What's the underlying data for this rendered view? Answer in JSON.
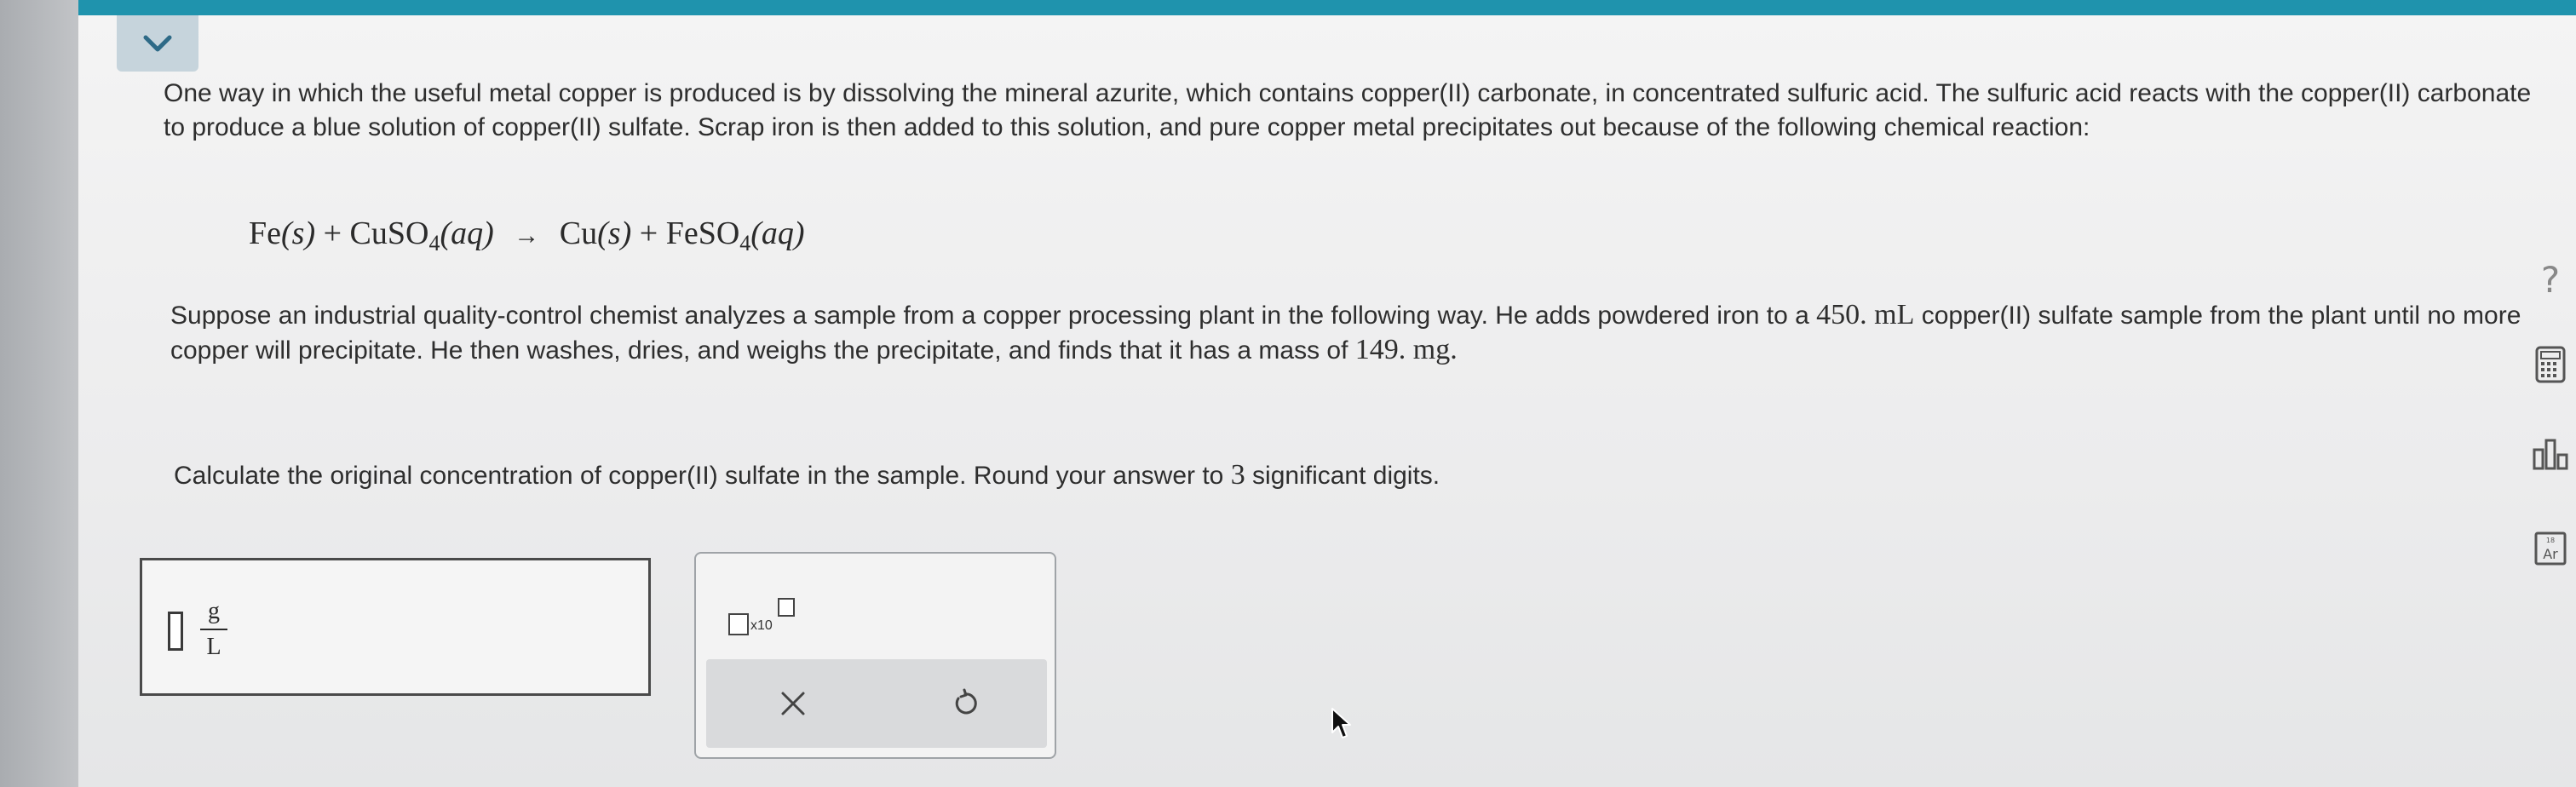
{
  "question": {
    "intro": "One way in which the useful metal copper is produced is by dissolving the mineral azurite, which contains copper(II) carbonate, in concentrated sulfuric acid. The sulfuric acid reacts with the copper(II) carbonate to produce a blue solution of copper(II) sulfate. Scrap iron is then added to this solution, and pure copper metal precipitates out because of the following chemical reaction:",
    "equation": {
      "r1": "Fe",
      "r1_state": "(s)",
      "plus1": "+",
      "r2": "CuSO",
      "r2_sub": "4",
      "r2_state": "(aq)",
      "arrow": "→",
      "p1": "Cu",
      "p1_state": "(s)",
      "plus2": "+",
      "p2": "FeSO",
      "p2_sub": "4",
      "p2_state": "(aq)"
    },
    "scenario_part1": "Suppose an industrial quality-control chemist analyzes a sample from a copper processing plant in the following way. He adds powdered iron to a",
    "volume": "450. mL",
    "scenario_part2": "copper(II) sulfate sample from the plant until no more copper will precipitate. He then washes, dries, and weighs the precipitate, and finds that it has a mass of",
    "mass": "149. mg",
    "scenario_end": ".",
    "instruction_part1": "Calculate the original concentration of copper(II) sulfate in the sample. Round your answer to",
    "sig_digits": "3",
    "instruction_part2": "significant digits."
  },
  "answer": {
    "value": "",
    "unit_numerator": "g",
    "unit_denominator": "L"
  },
  "toolbar": {
    "sci_label": "x10"
  },
  "side_tools": {
    "help": "?"
  },
  "colors": {
    "top_bar": "#1f93ad",
    "collapse_tab": "#c6d4dc",
    "page_bg": "#f0f0f0"
  },
  "icons": [
    "chevron-down-icon",
    "times-icon",
    "undo-icon",
    "help-icon",
    "calculator-icon",
    "data-chart-icon",
    "periodic-table-icon",
    "mouse-pointer-icon"
  ]
}
